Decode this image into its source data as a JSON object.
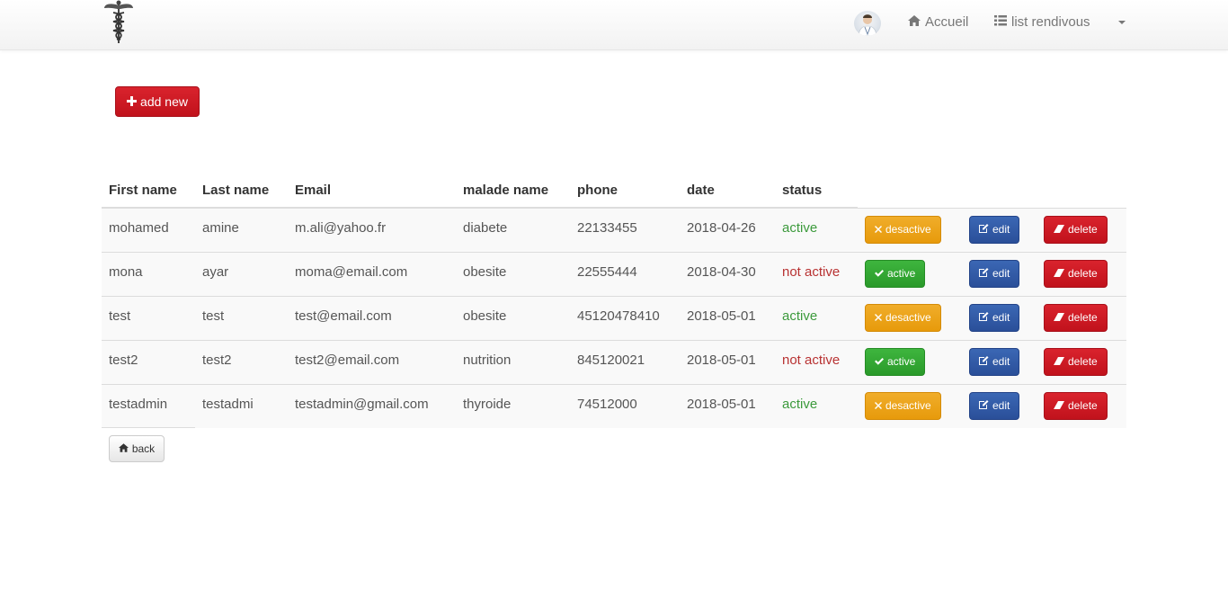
{
  "navbar": {
    "logo_icon": "caduceus-icon",
    "avatar_icon": "doctor-avatar",
    "home_label": "Accueil",
    "home_icon": "home-icon",
    "list_label": "list rendivous",
    "list_icon": "list-icon",
    "dropdown_icon": "caret-down-icon"
  },
  "toolbar": {
    "add_label": "add new",
    "add_icon": "plus-icon"
  },
  "table": {
    "columns": [
      "First name",
      "Last name",
      "Email",
      "malade name",
      "phone",
      "date",
      "status"
    ],
    "rows": [
      {
        "first": "mohamed",
        "last": "amine",
        "email": "m.ali@yahoo.fr",
        "malade": "diabete",
        "phone": "22133455",
        "date": "2018-04-26",
        "status": "active",
        "toggle_label": "desactive",
        "edit_label": "edit",
        "delete_label": "delete"
      },
      {
        "first": "mona",
        "last": "ayar",
        "email": "moma@email.com",
        "malade": "obesite",
        "phone": "22555444",
        "date": "2018-04-30",
        "status": "not active",
        "toggle_label": "active",
        "edit_label": "edit",
        "delete_label": "delete"
      },
      {
        "first": "test",
        "last": "test",
        "email": "test@email.com",
        "malade": "obesite",
        "phone": "45120478410",
        "date": "2018-05-01",
        "status": "active",
        "toggle_label": "desactive",
        "edit_label": "edit",
        "delete_label": "delete"
      },
      {
        "first": "test2",
        "last": "test2",
        "email": "test2@email.com",
        "malade": "nutrition",
        "phone": "845120021",
        "date": "2018-05-01",
        "status": "not active",
        "toggle_label": "active",
        "edit_label": "edit",
        "delete_label": "delete"
      },
      {
        "first": "testadmin",
        "last": "testadmi",
        "email": "testadmin@gmail.com",
        "malade": "thyroide",
        "phone": "74512000",
        "date": "2018-05-01",
        "status": "active",
        "toggle_label": "desactive",
        "edit_label": "edit",
        "delete_label": "delete"
      }
    ]
  },
  "footer": {
    "back_label": "back",
    "back_icon": "home-icon"
  },
  "colors": {
    "danger": "#c9151f",
    "warning": "#eca21a",
    "success": "#33a833",
    "primary": "#2f5aa6",
    "status_active": "#3c9a3c",
    "status_inactive": "#b83232"
  }
}
